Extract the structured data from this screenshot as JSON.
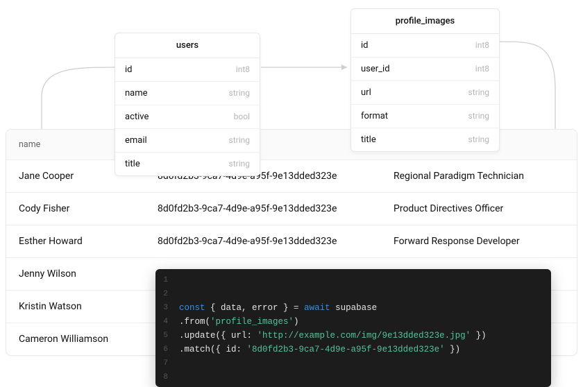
{
  "schema": {
    "users": {
      "title": "users",
      "rows": [
        {
          "name": "id",
          "type": "int8"
        },
        {
          "name": "name",
          "type": "string"
        },
        {
          "name": "active",
          "type": "bool"
        },
        {
          "name": "email",
          "type": "string"
        },
        {
          "name": "title",
          "type": "string"
        }
      ]
    },
    "profile_images": {
      "title": "profile_images",
      "rows": [
        {
          "name": "id",
          "type": "int8"
        },
        {
          "name": "user_id",
          "type": "int8"
        },
        {
          "name": "url",
          "type": "string"
        },
        {
          "name": "format",
          "type": "string"
        },
        {
          "name": "title",
          "type": "string"
        }
      ]
    }
  },
  "table": {
    "header": "name",
    "rows": [
      {
        "name": "Jane Cooper",
        "uuid": "8d0fd2b3-9ca7-4d9e-a95f-9e13dded323e",
        "title": "Regional Paradigm Technician"
      },
      {
        "name": "Cody Fisher",
        "uuid": "8d0fd2b3-9ca7-4d9e-a95f-9e13dded323e",
        "title": "Product Directives Officer"
      },
      {
        "name": "Esther Howard",
        "uuid": "8d0fd2b3-9ca7-4d9e-a95f-9e13dded323e",
        "title": "Forward Response Developer"
      },
      {
        "name": "Jenny Wilson",
        "uuid": "",
        "title": ""
      },
      {
        "name": "Kristin Watson",
        "uuid": "",
        "title": ""
      },
      {
        "name": "Cameron Williamson",
        "uuid": "",
        "title": ""
      }
    ]
  },
  "code": {
    "tokens": [
      [],
      [],
      [
        {
          "t": "kw",
          "v": "const"
        },
        {
          "t": "plain",
          "v": " { data, error } "
        },
        {
          "t": "punc",
          "v": "="
        },
        {
          "t": "plain",
          "v": " "
        },
        {
          "t": "kw",
          "v": "await"
        },
        {
          "t": "plain",
          "v": " supabase"
        }
      ],
      [
        {
          "t": "plain",
          "v": ".from("
        },
        {
          "t": "str",
          "v": "'profile_images'"
        },
        {
          "t": "plain",
          "v": ")"
        }
      ],
      [
        {
          "t": "plain",
          "v": ".update({ url: "
        },
        {
          "t": "str",
          "v": "'http://example.com/img/9e13dded323e.jpg'"
        },
        {
          "t": "plain",
          "v": " })"
        }
      ],
      [
        {
          "t": "plain",
          "v": ".match({ id: "
        },
        {
          "t": "str",
          "v": "'8d0fd2b3-9ca7-4d9e-a95f-9e13dded323e'"
        },
        {
          "t": "plain",
          "v": " })"
        }
      ],
      [],
      []
    ]
  }
}
